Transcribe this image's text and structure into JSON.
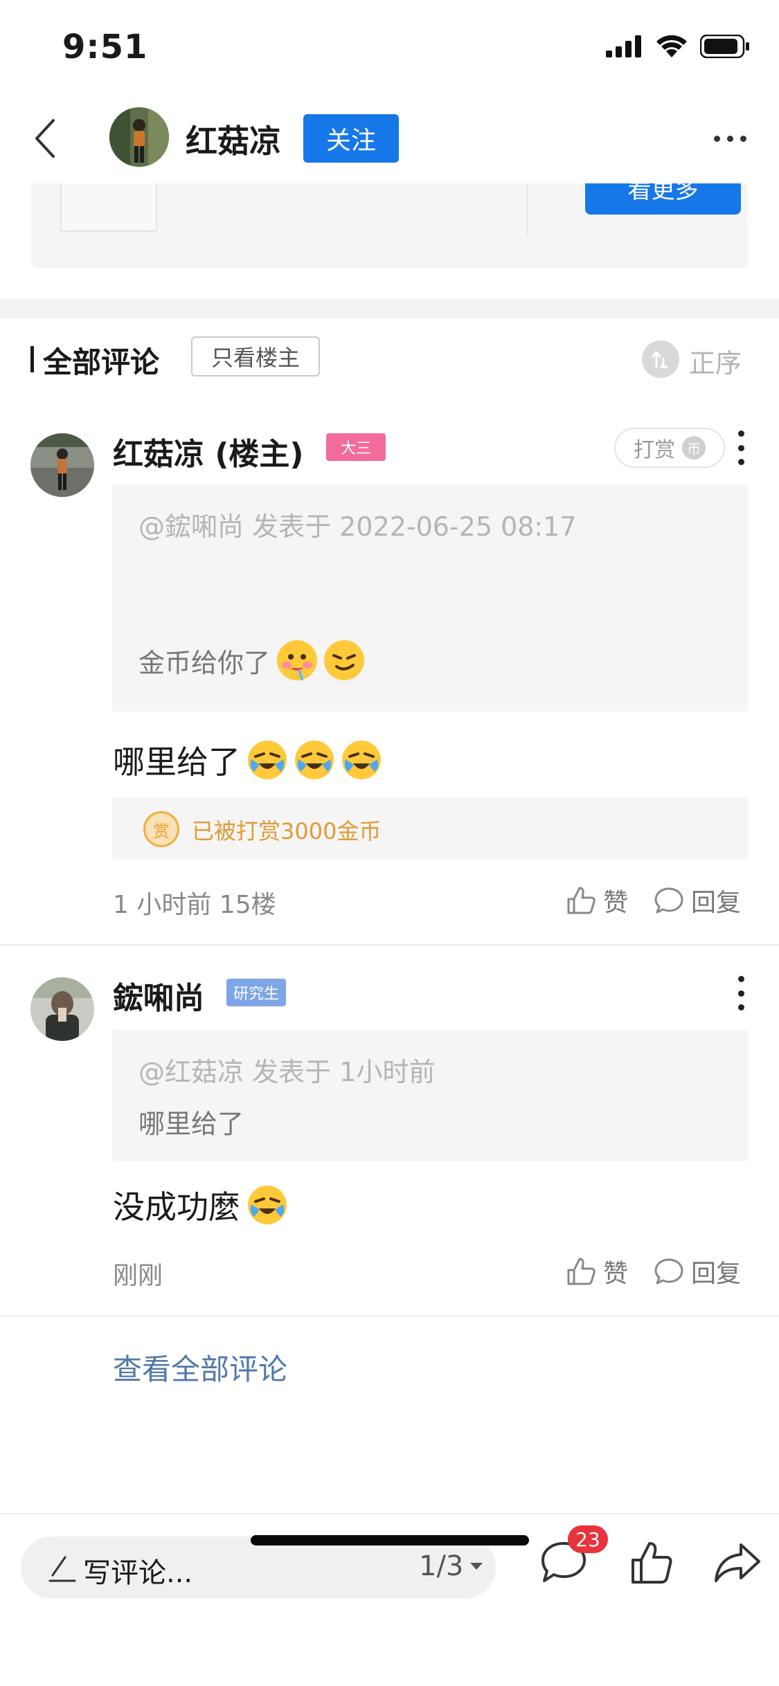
{
  "status_bar": {
    "time": "9:51"
  },
  "nav": {
    "username": "红菇凉",
    "follow_label": "关注"
  },
  "top_card": {
    "button_label": "看更多"
  },
  "comments_header": {
    "title": "全部评论",
    "only_op_label": "只看楼主",
    "sort_label": "正序"
  },
  "comments": [
    {
      "name": "红菇凉 (楼主)",
      "badge": "大三",
      "badge_color": "#f36b9c",
      "tip_label": "打赏",
      "tip_coin": "币",
      "quote_meta": "@鋐啝尚 发表于 2022-06-25 08:17",
      "quote_text": "金币给你了",
      "text": "哪里给了",
      "reward_icon": "赏",
      "reward_text": "已被打赏3000金币",
      "meta": "1 小时前  15楼",
      "like_label": "赞",
      "reply_label": "回复"
    },
    {
      "name": "鋐啝尚",
      "badge": "研究生",
      "badge_color": "#7ea6e6",
      "quote_meta": "@红菇凉 发表于 1小时前",
      "quote_text": "哪里给了",
      "text": "没成功麼",
      "meta": "刚刚",
      "like_label": "赞",
      "reply_label": "回复"
    }
  ],
  "view_all_label": "查看全部评论",
  "bottom_bar": {
    "write_placeholder": "写评论...",
    "page_indicator": "1/3",
    "comment_count": "23"
  },
  "colors": {
    "accent": "#1677e8",
    "badge_red": "#e8323c",
    "reward": "#e39a33",
    "link": "#5278a8"
  },
  "icons": [
    "back-icon",
    "more-icon",
    "signal-icon",
    "wifi-icon",
    "battery-icon",
    "sort-icon",
    "like-icon",
    "reply-icon",
    "pencil-icon",
    "chevron-down-icon",
    "comment-icon",
    "thumb-icon",
    "share-icon"
  ]
}
